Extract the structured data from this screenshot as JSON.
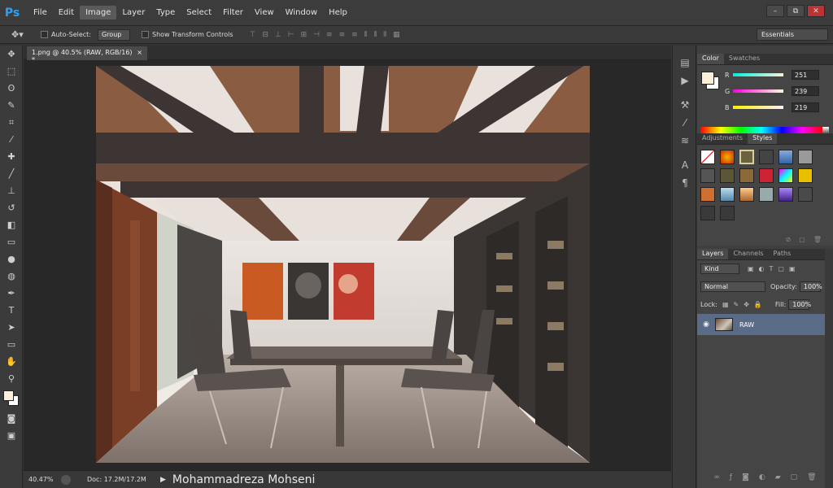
{
  "app": {
    "logo": "Ps"
  },
  "menu": [
    "File",
    "Edit",
    "Image",
    "Layer",
    "Type",
    "Select",
    "Filter",
    "View",
    "Window",
    "Help"
  ],
  "menu_active": "Image",
  "window_controls": {
    "minimize": "–",
    "restore": "⧉",
    "close": "✕"
  },
  "options": {
    "auto_select_label": "Auto-Select:",
    "auto_select_value": "Group",
    "show_transform_label": "Show Transform Controls",
    "workspace": "Essentials"
  },
  "document": {
    "tab_title": "1.png @ 40.5% (RAW, RGB/16) *",
    "close": "×"
  },
  "status": {
    "zoom": "40.47%",
    "doc_info": "Doc: 17.2M/17.2M",
    "watermark": "Mohammadreza Mohseni"
  },
  "color_panel": {
    "tabs": [
      "Color",
      "Swatches"
    ],
    "active_tab": "Color",
    "r_label": "R",
    "r_value": "251",
    "g_label": "G",
    "g_value": "239",
    "b_label": "B",
    "b_value": "219",
    "foreground": "#fbefdb"
  },
  "styles_panel": {
    "tabs": [
      "Adjustments",
      "Styles"
    ],
    "active_tab": "Styles"
  },
  "layers_panel": {
    "tabs": [
      "Layers",
      "Channels",
      "Paths"
    ],
    "active_tab": "Layers",
    "filter": "Kind",
    "blend_mode": "Normal",
    "opacity_label": "Opacity:",
    "opacity_value": "100%",
    "lock_label": "Lock:",
    "fill_label": "Fill:",
    "fill_value": "100%",
    "layers": [
      {
        "name": "RAW",
        "visible": true
      }
    ]
  }
}
